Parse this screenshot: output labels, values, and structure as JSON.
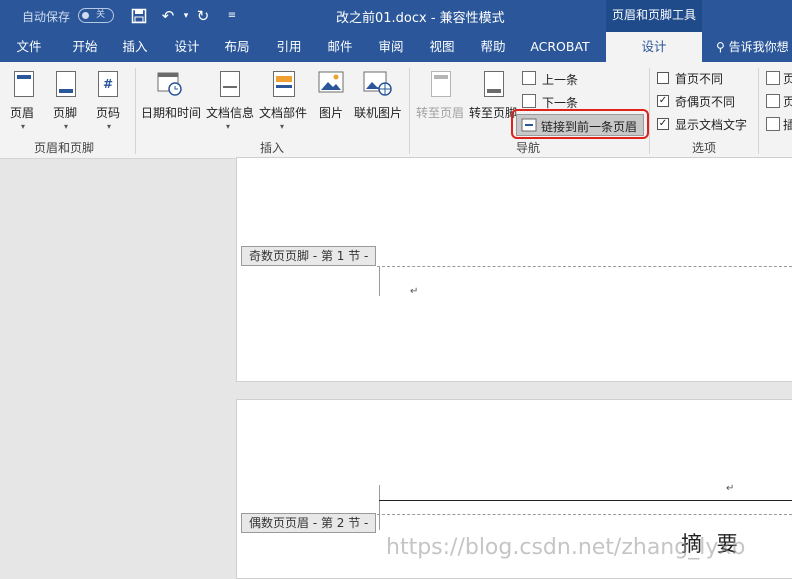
{
  "titlebar": {
    "autosave_label": "自动保存",
    "autosave_state": "关",
    "document_title": "改之前01.docx  -  兼容性模式",
    "context_tool": "页眉和页脚工具"
  },
  "tabs": [
    "文件",
    "开始",
    "插入",
    "设计",
    "布局",
    "引用",
    "邮件",
    "审阅",
    "视图",
    "帮助",
    "ACROBAT",
    "设计"
  ],
  "tell_me": "告诉我你想",
  "ribbon": {
    "header_footer": {
      "group": "页眉和页脚",
      "header": "页眉",
      "footer": "页脚",
      "page_number": "页码"
    },
    "insert": {
      "group": "插入",
      "date_time": "日期和时间",
      "doc_info": "文档信息",
      "doc_parts": "文档部件",
      "picture": "图片",
      "online_picture": "联机图片"
    },
    "navigation": {
      "group": "导航",
      "goto_header": "转至页眉",
      "goto_footer": "转至页脚",
      "previous": "上一条",
      "next": "下一条",
      "link_to_previous": "链接到前一条页眉"
    },
    "options": {
      "group": "选项",
      "different_first": "首页不同",
      "different_odd_even": "奇偶页不同",
      "show_doc_text": "显示文档文字",
      "different_first_checked": false,
      "different_odd_even_checked": true,
      "show_doc_text_checked": true
    },
    "position": {
      "r1": "页",
      "r2": "页",
      "r3": "插"
    }
  },
  "document": {
    "odd_footer_label": "奇数页页脚 - 第 1 节 -",
    "even_header_label": "偶数页页眉 - 第 2 节 -",
    "paragraph_mark": "↵",
    "abstract_heading": "摘  要"
  },
  "watermark": "https://blog.csdn.net/zhang_lyxb",
  "colors": {
    "word_blue": "#2b579a",
    "context_tab": "#1f4b8a",
    "highlight_red": "#e0231a"
  }
}
